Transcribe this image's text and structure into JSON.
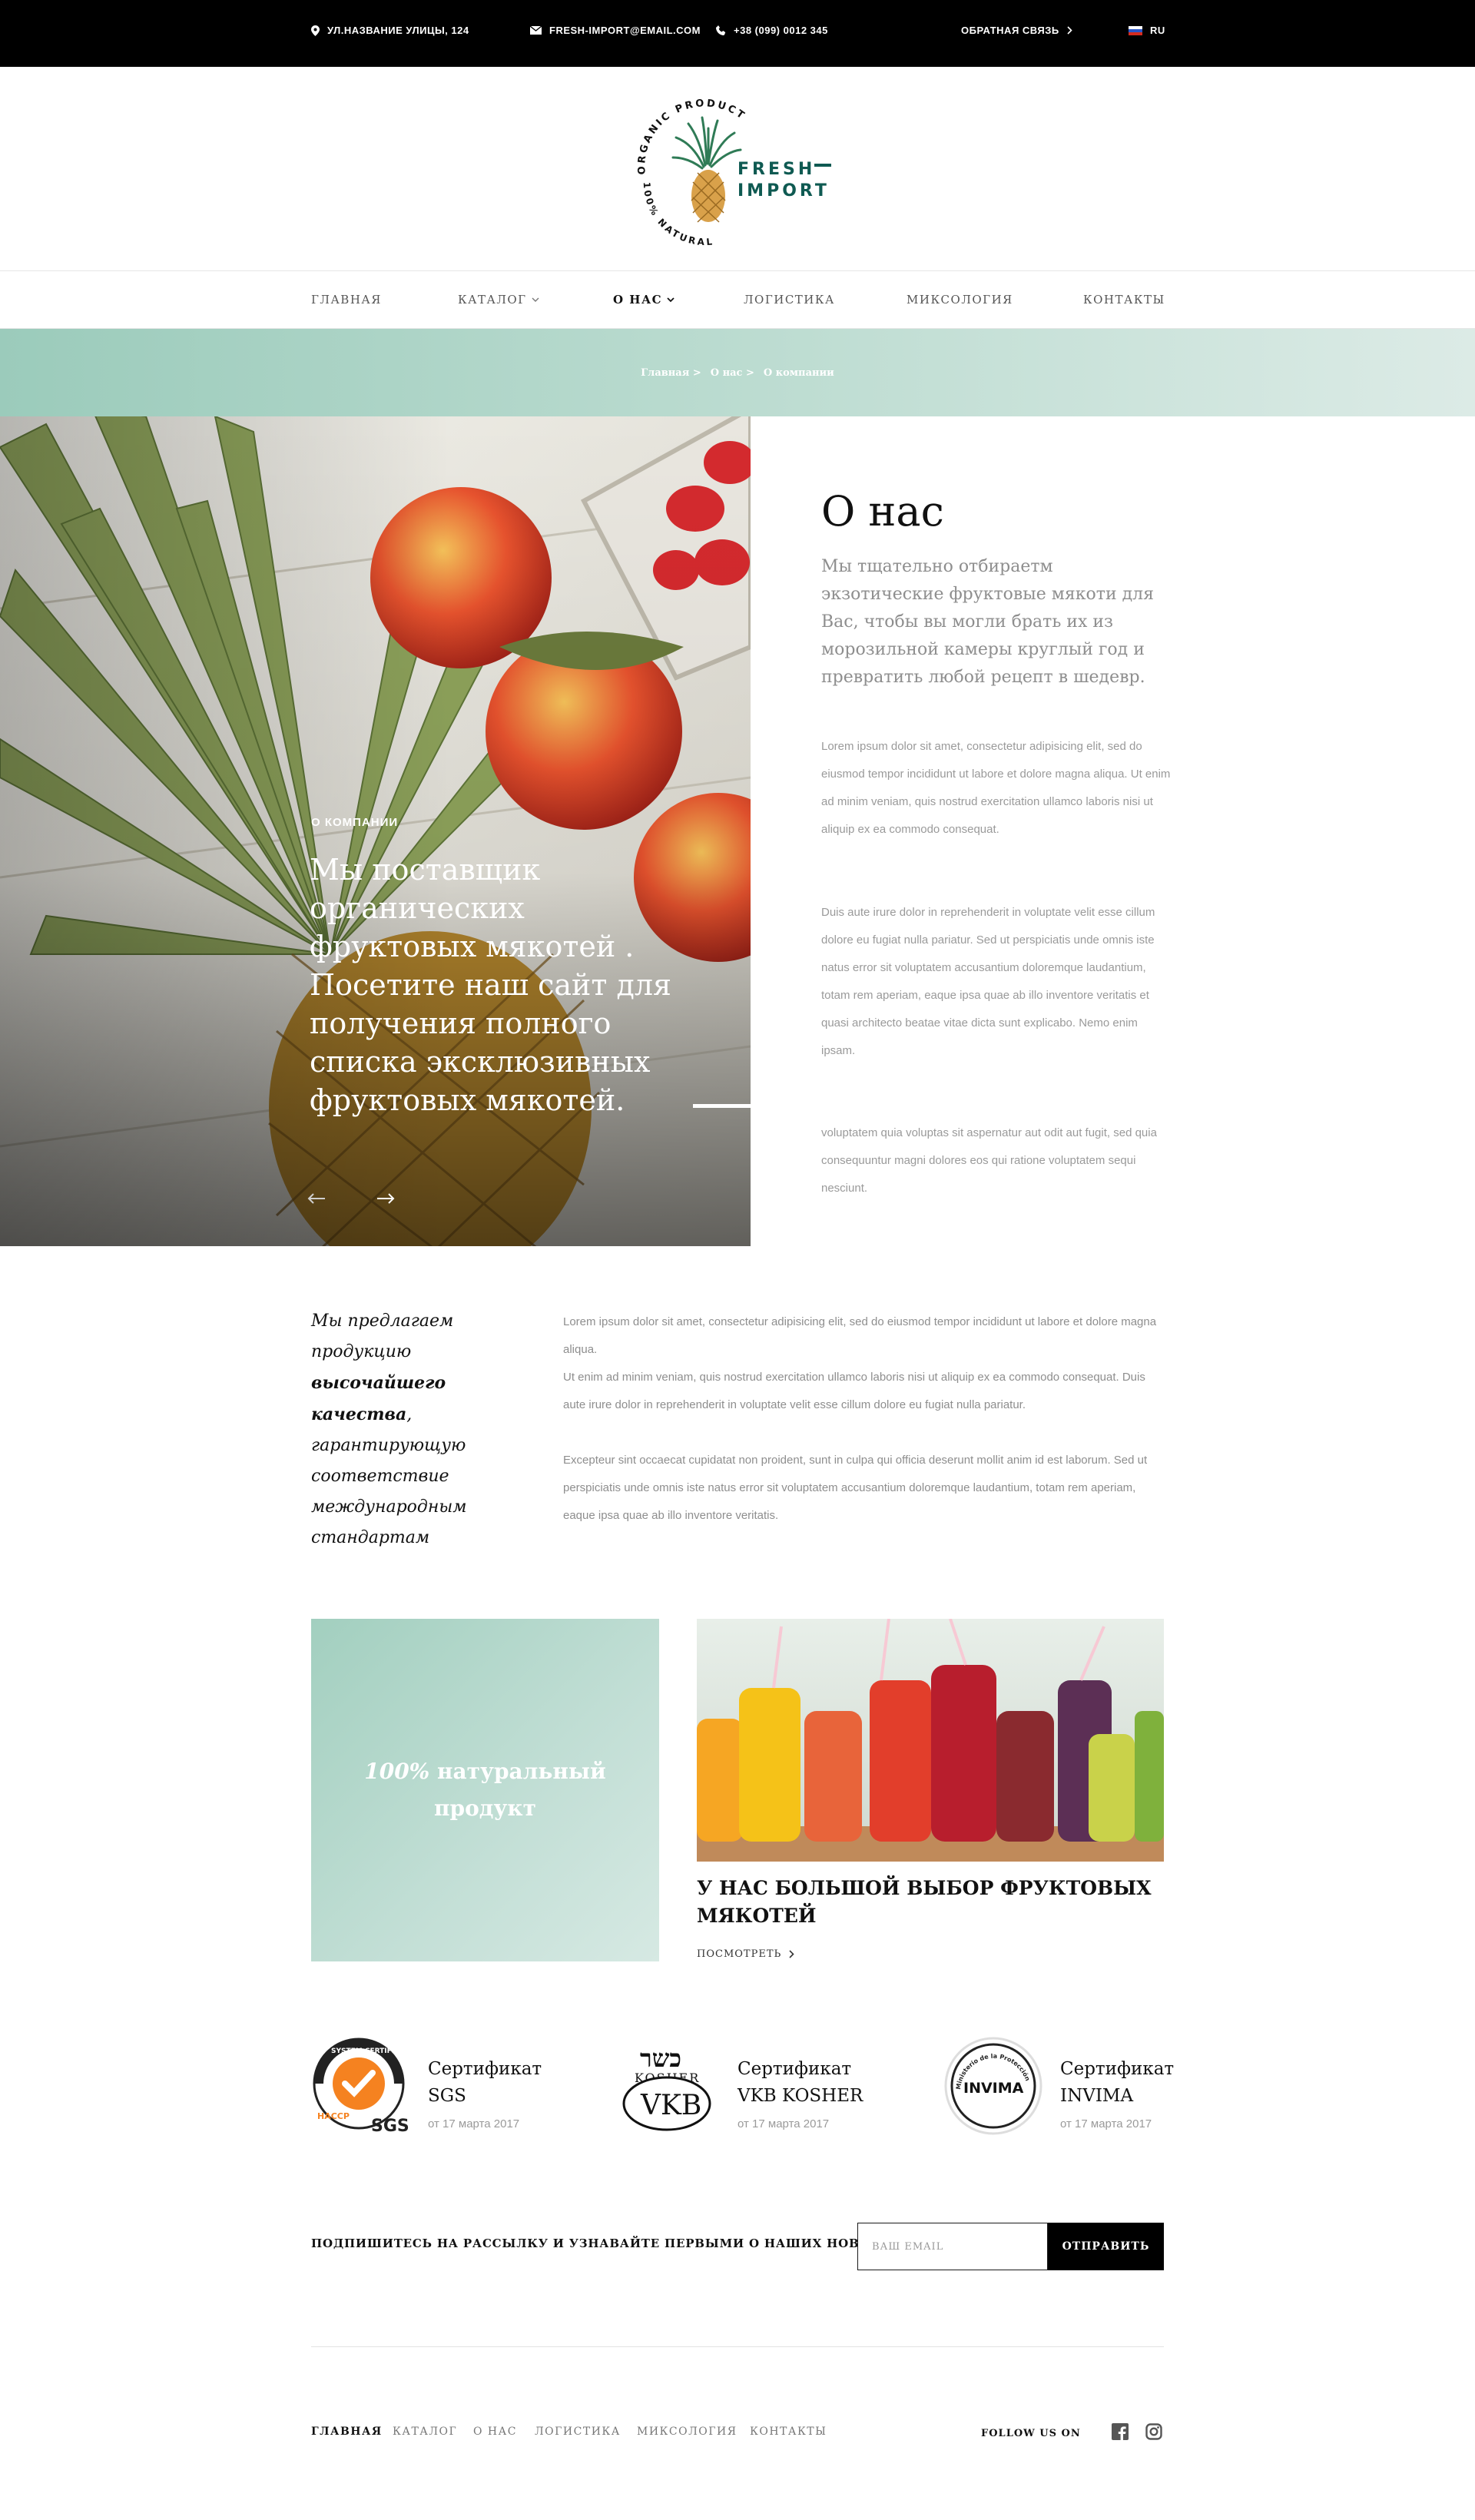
{
  "topbar": {
    "address": "УЛ.НАЗВАНИЕ УЛИЦЫ, 124",
    "email": "FRESH-IMPORT@EMAIL.COM",
    "phone": "+38 (099) 0012 345",
    "feedback": "ОБРАТНАЯ СВЯЗЬ",
    "lang": "RU"
  },
  "logo": {
    "brand_line1": "FRESH",
    "brand_line2": "IMPORT",
    "ring_top": "ORGANIC PRODUCT",
    "ring_bottom": "100% NATURAL"
  },
  "nav": [
    {
      "label": "ГЛАВНАЯ"
    },
    {
      "label": "КАТАЛОГ"
    },
    {
      "label": "О НАС"
    },
    {
      "label": "ЛОГИСТИКА"
    },
    {
      "label": "МИКСОЛОГИЯ"
    },
    {
      "label": "КОНТАКТЫ"
    }
  ],
  "breadcrumb": [
    "Главная >",
    "О нас >",
    "О компании"
  ],
  "hero": {
    "eyebrow": "О КОМПАНИИ",
    "headline": "Мы поставщик органических фруктовых мякотей . Посетите наш сайт для получения полного списка эксклюзивных фруктовых мякотей."
  },
  "about": {
    "title": "О нас",
    "lead": "Мы тщательно отбираетм экзотические фруктовые мякоти для Вас, чтобы вы могли брать их из морозильной камеры круглый год и превратить любой рецепт в шедевр.",
    "p1": "Lorem ipsum dolor sit amet, consectetur adipisicing elit, sed do eiusmod tempor incididunt ut labore et dolore magna aliqua. Ut enim ad minim veniam, quis nostrud exercitation ullamco laboris nisi ut aliquip ex ea commodo consequat.",
    "p2": "Duis aute irure dolor in reprehenderit in voluptate velit esse cillum dolore eu fugiat nulla pariatur. Sed ut perspiciatis unde omnis iste natus error sit voluptatem accusantium doloremque laudantium, totam rem aperiam, eaque ipsa quae ab illo inventore veritatis et quasi architecto beatae vitae dicta sunt explicabo. Nemo enim ipsam.",
    "p3": "voluptatem quia voluptas sit aspernatur aut odit aut fugit, sed quia consequuntur magni dolores eos qui ratione voluptatem sequi nesciunt."
  },
  "offer": {
    "tag_a": "Мы предлагаем продукцию",
    "tag_b": "высочайшего качества",
    "tag_c": ", гарантирующую соответствие международным стандартам",
    "p1": "Lorem ipsum dolor sit amet, consectetur adipisicing elit, sed do eiusmod tempor incididunt ut labore et dolore magna aliqua.",
    "p2": "Ut enim ad minim veniam, quis nostrud exercitation ullamco laboris nisi ut aliquip ex ea commodo consequat. Duis aute irure dolor in reprehenderit in voluptate velit esse cillum dolore eu fugiat nulla pariatur.",
    "p3": "Excepteur sint occaecat cupidatat non proident, sunt in culpa qui officia deserunt mollit anim id est laborum. Sed ut perspiciatis unde omnis iste natus error sit voluptatem accusantium doloremque laudantium, totam rem aperiam, eaque ipsa quae ab illo inventore veritatis."
  },
  "cards": {
    "natural_em": "100%",
    "natural_rest": "натуральный продукт",
    "selection_title": "У НАС БОЛЬШОЙ ВЫБОР ФРУКТОВЫХ МЯКОТЕЙ",
    "selection_link": "ПОСМОТРЕТЬ"
  },
  "certs": [
    {
      "title1": "Сертификат",
      "title2": "SGS",
      "date": "от 17 марта 2017",
      "badge_text": "SGS",
      "badge_sub": "HACCP",
      "badge_ring": "SYSTEM CERTIFICATION"
    },
    {
      "title1": "Сертификат",
      "title2": "VKB KOSHER",
      "date": "от 17 марта 2017",
      "badge_text": "VKB",
      "badge_sub": "KOSHER",
      "badge_top": "כשר"
    },
    {
      "title1": "Сертификат",
      "title2": "INVIMA",
      "date": "от 17 марта 2017",
      "badge_text": "INVIMA",
      "badge_ring": "Ministerio de la Protección Social"
    }
  ],
  "subscribe": {
    "text": "ПОДПИШИТЕСЬ НА РАССЫЛКУ И УЗНАВАЙТЕ ПЕРВЫМИ О НАШИХ НОВОСТЯХ",
    "placeholder": "ВАШ EMAIL",
    "button": "ОТПРАВИТЬ"
  },
  "footer": {
    "nav": [
      "ГЛАВНАЯ",
      "КАТАЛОГ",
      "О НАС",
      "ЛОГИСТИКА",
      "МИКСОЛОГИЯ",
      "КОНТАКТЫ"
    ],
    "follow": "FOLLOW US ON"
  },
  "colors": {
    "accent_green": "#a8d2c3",
    "brand_teal": "#0f5a52",
    "black": "#000000"
  }
}
